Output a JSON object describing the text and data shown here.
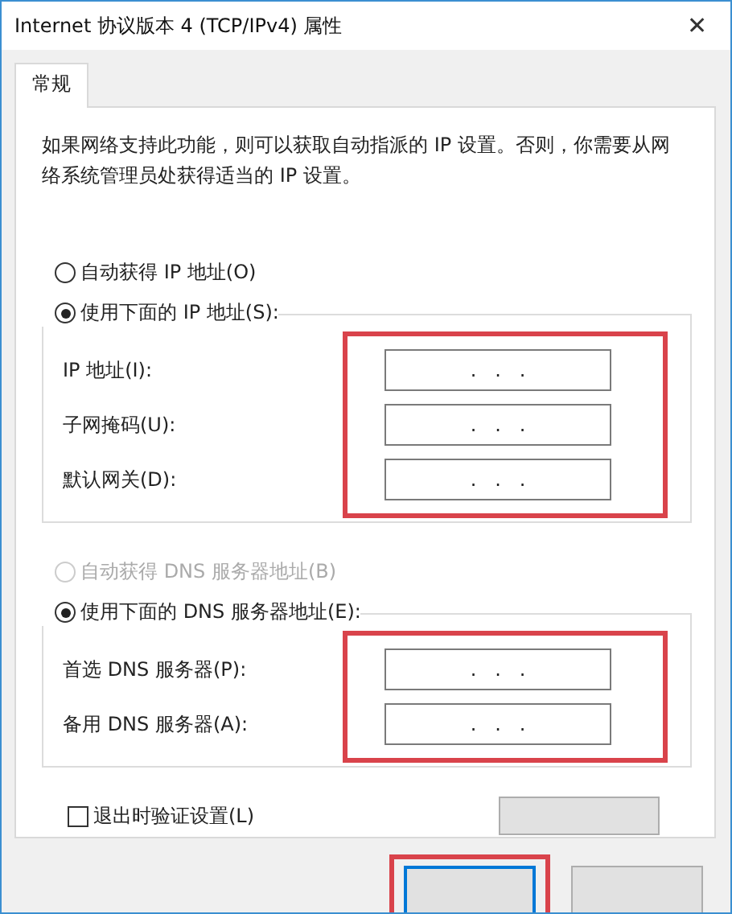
{
  "window": {
    "title": "Internet 协议版本 4 (TCP/IPv4) 属性",
    "close": "✕"
  },
  "tabs": [
    {
      "label": "常规",
      "selected": true
    }
  ],
  "description": "如果网络支持此功能，则可以获取自动指派的 IP 设置。否则，你需要从网络系统管理员处获得适当的 IP 设置。",
  "groups": [
    {
      "options": [
        {
          "label": "自动获得 IP 地址(O)",
          "selected": false,
          "disabled": false
        },
        {
          "label": "使用下面的 IP 地址(S):",
          "selected": true,
          "disabled": false
        }
      ],
      "highlighted": true,
      "fields": [
        {
          "label": "IP 地址(I):",
          "value": ".   .   ."
        },
        {
          "label": "子网掩码(U):",
          "value": ".   .   ."
        },
        {
          "label": "默认网关(D):",
          "value": ".   .   ."
        }
      ]
    },
    {
      "options": [
        {
          "label": "自动获得 DNS 服务器地址(B)",
          "selected": false,
          "disabled": true
        },
        {
          "label": "使用下面的 DNS 服务器地址(E):",
          "selected": true,
          "disabled": false
        }
      ],
      "highlighted": true,
      "fields": [
        {
          "label": "首选 DNS 服务器(P):",
          "value": ".   .   ."
        },
        {
          "label": "备用 DNS 服务器(A):",
          "value": ".   .   ."
        }
      ]
    }
  ],
  "validate": {
    "label": "退出时验证设置(L)",
    "checked": false
  },
  "buttons": [
    {
      "kind": "default",
      "highlighted": true
    },
    {
      "kind": "normal",
      "highlighted": false
    }
  ]
}
